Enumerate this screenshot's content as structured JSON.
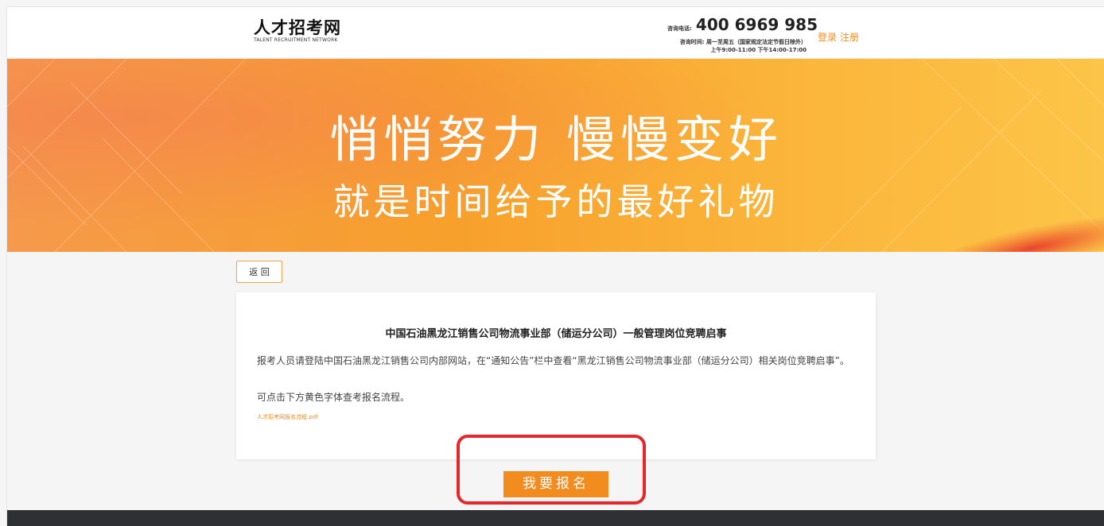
{
  "header": {
    "logo_cn": "人才招考网",
    "logo_en": "TALENT RECRUITMENT NETWORK",
    "phone_label": "咨询电话:",
    "phone": "400 6969 985",
    "hours_line1": "咨询时间: 周一至周五（国家规定法定节假日除外）",
    "hours_line2": "上午9:00-11:00 下午14:00-17:00",
    "login": "登录",
    "register": "注册"
  },
  "banner": {
    "line1": "悄悄努力 慢慢变好",
    "line2": "就是时间给予的最好礼物"
  },
  "back_label": "返 回",
  "article": {
    "title": "中国石油黑龙江销售公司物流事业部（储运分公司）一般管理岗位竞聘启事",
    "paragraph1": "报考人员请登陆中国石油黑龙江销售公司内部网站，在“通知公告”栏中查看“黑龙江销售公司物流事业部（储运分公司）相关岗位竞聘启事”。",
    "paragraph2": "可点击下方黄色字体查考报名流程。",
    "attachment": "人才招考网报名流程.pdf"
  },
  "apply_label": "我要报名",
  "colors": {
    "accent": "#f28c1e",
    "highlight": "#e5262b",
    "footer": "#2e3033"
  }
}
